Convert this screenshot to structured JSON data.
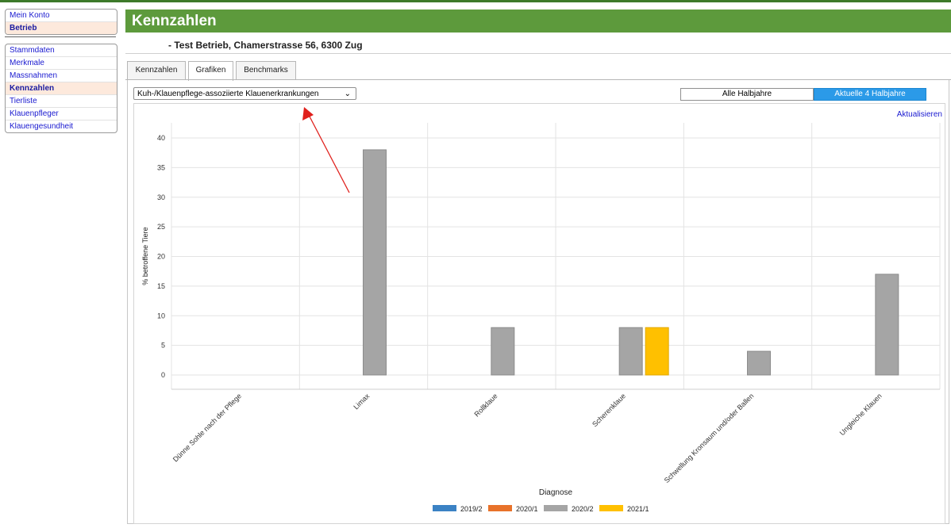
{
  "sidebar": {
    "top_items": [
      {
        "label": "Mein Konto",
        "active": false
      },
      {
        "label": "Betrieb",
        "active": true
      }
    ],
    "items": [
      {
        "label": "Stammdaten",
        "active": false
      },
      {
        "label": "Merkmale",
        "active": false
      },
      {
        "label": "Massnahmen",
        "active": false
      },
      {
        "label": "Kennzahlen",
        "active": true
      },
      {
        "label": "Tierliste",
        "active": false
      },
      {
        "label": "Klauenpfleger",
        "active": false
      },
      {
        "label": "Klauengesundheit",
        "active": false
      }
    ]
  },
  "header": {
    "title": "Kennzahlen",
    "subtitle": "- Test Betrieb, Chamerstrasse 56, 6300 Zug"
  },
  "tabs": [
    {
      "label": "Kennzahlen",
      "active": false
    },
    {
      "label": "Grafiken",
      "active": true
    },
    {
      "label": "Benchmarks",
      "active": false
    }
  ],
  "controls": {
    "category_select": "Kuh-/Klauenpflege-assoziierte Klauenerkrankungen",
    "btn_all": "Alle Halbjahre",
    "btn_current": "Aktuelle 4 Halbjahre",
    "refresh": "Aktualisieren"
  },
  "colors": {
    "accent": "#5d9a3c",
    "button_active": "#2b9ae8",
    "annotation_arrow": "#e0201c"
  },
  "chart_data": {
    "type": "bar",
    "categories": [
      "Dünne Sohle nach der Pflege",
      "Limax",
      "Rollklaue",
      "Scherenklaue",
      "Schwellung Kronsaum und/oder Ballen",
      "Ungleiche Klauen"
    ],
    "series": [
      {
        "name": "2019/2",
        "color": "#3b82c4",
        "values": [
          null,
          null,
          null,
          null,
          null,
          null
        ]
      },
      {
        "name": "2020/1",
        "color": "#e8722a",
        "values": [
          null,
          null,
          null,
          null,
          null,
          null
        ]
      },
      {
        "name": "2020/2",
        "color": "#a5a5a5",
        "values": [
          null,
          38,
          8,
          8,
          4,
          17
        ]
      },
      {
        "name": "2021/1",
        "color": "#ffc000",
        "values": [
          null,
          null,
          null,
          8,
          null,
          null
        ]
      }
    ],
    "xlabel": "Diagnose",
    "ylabel": "% betroffene Tiere",
    "ylim": [
      0,
      40
    ],
    "yticks": [
      0,
      5,
      10,
      15,
      20,
      25,
      30,
      35,
      40
    ],
    "grid": true,
    "legend": "bottom"
  }
}
